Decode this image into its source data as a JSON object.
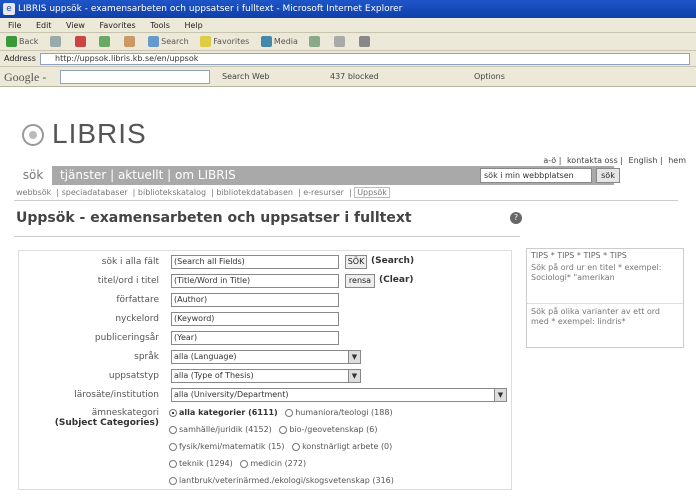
{
  "window": {
    "title": "LIBRIS uppsök - examensarbeten och uppsatser i fulltext - Microsoft Internet Explorer"
  },
  "menubar": [
    "File",
    "Edit",
    "View",
    "Favorites",
    "Tools",
    "Help"
  ],
  "toolbar": {
    "back": "Back",
    "search": "Search",
    "favorites": "Favorites",
    "media": "Media"
  },
  "address": {
    "label": "Address",
    "value": "http://uppsok.libris.kb.se/en/uppsok"
  },
  "googlebar": {
    "logo": "Google -",
    "search_web": "Search Web",
    "blocked": "437 blocked",
    "options": "Options"
  },
  "site": {
    "logo": "LIBRIS",
    "top_links": [
      "a-ö",
      "kontakta oss",
      "English",
      "hem"
    ],
    "nav": {
      "sok": "sök",
      "items": "tjänster | aktuellt | om LIBRIS"
    },
    "mini_search_value": "sök i min webbplatsen",
    "mini_search_button": "sök",
    "subnav": [
      "webbsök",
      "speciadatabaser",
      "bibliotekskatalog",
      "bibliotekdatabasen",
      "e-resurser",
      "Uppsök"
    ]
  },
  "page_title": "Uppsök - examensarbeten och uppsatser i fulltext",
  "form": {
    "search_all": {
      "label": "sök i alla fält",
      "value": "(Search all Fields)"
    },
    "search_btn": "SÖK",
    "search_btn_label": "(Search)",
    "title": {
      "label": "titel/ord i titel",
      "value": "(Title/Word in Title)"
    },
    "clear_btn": "rensa",
    "clear_btn_label": "(Clear)",
    "author": {
      "label": "författare",
      "value": "(Author)"
    },
    "keyword": {
      "label": "nyckelord",
      "value": "(Keyword)"
    },
    "year": {
      "label": "publiceringsår",
      "value": "(Year)"
    },
    "language": {
      "label": "språk",
      "value": "alla (Language)"
    },
    "thesis_type": {
      "label": "uppsatstyp",
      "value": "alla (Type of Thesis)"
    },
    "university": {
      "label": "lärosäte/institution",
      "value": "alla (University/Department)"
    },
    "subject": {
      "label": "ämneskategori",
      "label_en": "(Subject Categories)",
      "options": [
        [
          "alla kategorier (6111)",
          "humaniora/teologi (188)"
        ],
        [
          "samhälle/juridik (4152)",
          "bio-/geovetenskap (6)"
        ],
        [
          "fysik/kemi/matematik (15)",
          "konstnärligt arbete (0)"
        ],
        [
          "teknik (1294)",
          "medicin (272)"
        ],
        [
          "lantbruk/veterinärmed./ekologi/skogsvetenskap (316)"
        ]
      ]
    }
  },
  "tips": {
    "header": "TIPS * TIPS * TIPS * TIPS",
    "tip1": "Sök på ord ur en titel * exempel: Sociologi* \"amerikan",
    "tip2": "Sök på olika varianter av ett ord med * exempel: lindris*"
  }
}
